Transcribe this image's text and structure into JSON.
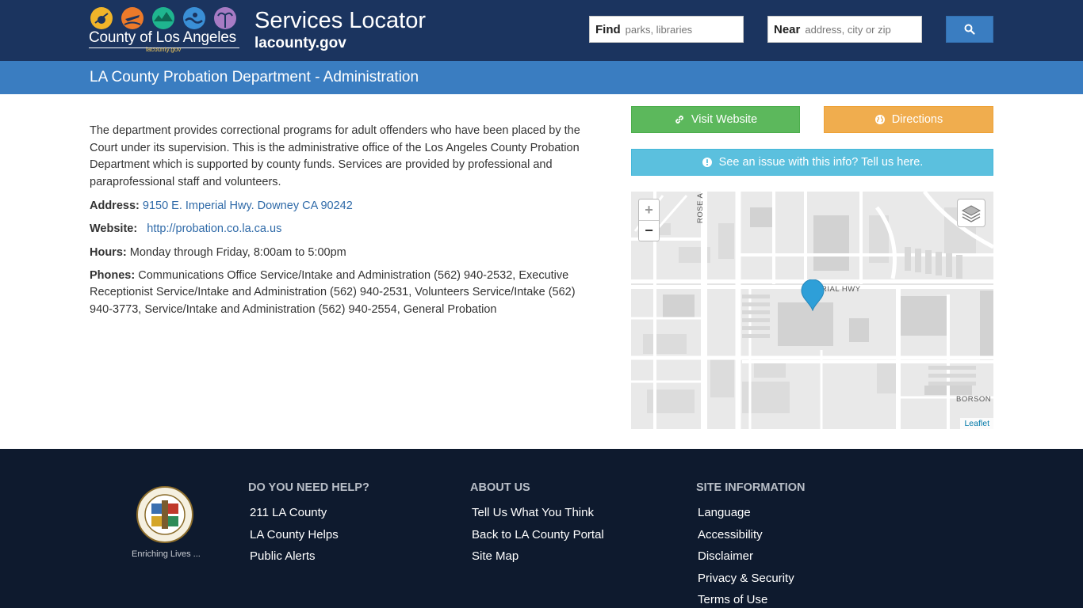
{
  "header": {
    "logo_text": "County of Los Angeles",
    "logo_subtext": "lacounty.gov",
    "logo_icon_colors": [
      "#f0b429",
      "#ec7a2a",
      "#1fb58f",
      "#3a8fd6",
      "#a77bc4"
    ],
    "site_title": "Services Locator",
    "site_subtitle": "lacounty.gov",
    "find_label": "Find",
    "find_placeholder": "parks, libraries",
    "near_label": "Near",
    "near_placeholder": "address, city or zip"
  },
  "page_title": "LA County Probation Department - Administration",
  "details": {
    "description": "The department provides correctional programs for adult offenders who have been placed by the Court under its supervision.  This is the administrative office of the Los Angeles County Probation Department which is supported by county funds.  Services are provided by professional and paraprofessional staff and volunteers.",
    "address_label": "Address:",
    "address_value": "9150 E. Imperial Hwy. Downey CA 90242",
    "website_label": "Website:",
    "website_value": "http://probation.co.la.ca.us",
    "hours_label": "Hours:",
    "hours_value": "Monday through Friday, 8:00am to 5:00pm",
    "phones_label": "Phones:",
    "phones_value": "Communications Office Service/Intake and Administration (562) 940-2532, Executive Receptionist Service/Intake and Administration (562) 940-2531, Volunteers Service/Intake (562) 940-3773, Service/Intake and Administration (562) 940-2554, General Probation"
  },
  "actions": {
    "visit_label": "Visit Website",
    "directions_label": "Directions",
    "issue_label": "See an issue with this info? Tell us here.",
    "colors": {
      "visit": "#5cb85c",
      "directions": "#f0ad4e",
      "issue": "#5bc0de"
    }
  },
  "map": {
    "zoom_in": "+",
    "zoom_out": "−",
    "street_imperial": "RIAL HWY",
    "street_rose": "ROSE A",
    "street_borson": "BORSON",
    "attribution": "Leaflet",
    "marker_color": "#2e9fd8"
  },
  "footer": {
    "seal_caption": "Enriching Lives ...",
    "col_help": {
      "heading": "DO YOU NEED HELP?",
      "links": [
        "211 LA County",
        "LA County Helps",
        "Public Alerts"
      ]
    },
    "col_about": {
      "heading": "ABOUT US",
      "links": [
        "Tell Us What You Think",
        "Back to LA County Portal",
        "Site Map"
      ]
    },
    "col_site": {
      "heading": "SITE INFORMATION",
      "links": [
        "Language",
        "Accessibility",
        "Disclaimer",
        "Privacy & Security",
        "Terms of Use"
      ]
    }
  }
}
